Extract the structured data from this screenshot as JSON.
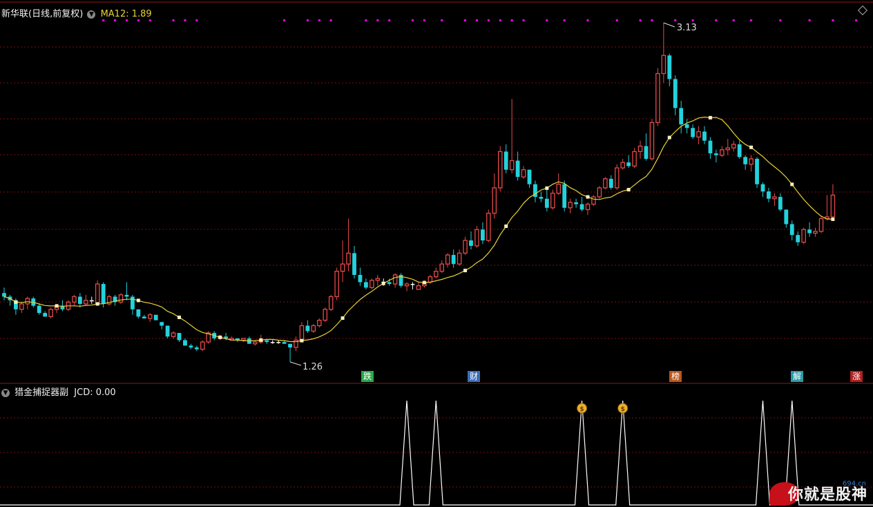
{
  "header": {
    "stock_title": "新华联(日线,前复权)",
    "ma_label": "MA12: 1.89",
    "indicator_title": "猎金捕捉器副",
    "indicator_value": "JCD: 0.00"
  },
  "annotations": {
    "high_label": "3.13",
    "low_label": "1.26"
  },
  "events": [
    {
      "text": "跌",
      "color": "#2aa84a"
    },
    {
      "text": "财",
      "color": "#3a6fb8"
    },
    {
      "text": "榜",
      "color": "#b8561f"
    },
    {
      "text": "解",
      "color": "#2b9aa8"
    },
    {
      "text": "涨",
      "color": "#b02020"
    }
  ],
  "colors": {
    "up": "#e84a4a",
    "down": "#22d2dc",
    "ma": "#e8d23a",
    "grid": "#7a1010",
    "signal": "#ff00ff"
  },
  "icons": [
    "money-bag-icon",
    "money-bag-icon"
  ],
  "watermark": {
    "site": "694.cn",
    "slogan": "你就是股神"
  },
  "chart_data": {
    "type": "candlestick",
    "price_range": [
      1.26,
      3.13
    ],
    "ma_period": 12,
    "candles": [
      [
        1.64,
        1.67,
        1.6,
        1.62
      ],
      [
        1.62,
        1.63,
        1.57,
        1.6
      ],
      [
        1.6,
        1.61,
        1.52,
        1.55
      ],
      [
        1.55,
        1.59,
        1.53,
        1.58
      ],
      [
        1.58,
        1.62,
        1.55,
        1.61
      ],
      [
        1.61,
        1.62,
        1.56,
        1.57
      ],
      [
        1.57,
        1.58,
        1.52,
        1.53
      ],
      [
        1.53,
        1.54,
        1.51,
        1.51
      ],
      [
        1.51,
        1.56,
        1.5,
        1.55
      ],
      [
        1.55,
        1.58,
        1.53,
        1.57
      ],
      [
        1.57,
        1.6,
        1.54,
        1.55
      ],
      [
        1.55,
        1.6,
        1.54,
        1.59
      ],
      [
        1.59,
        1.63,
        1.57,
        1.62
      ],
      [
        1.62,
        1.64,
        1.56,
        1.58
      ],
      [
        1.58,
        1.63,
        1.57,
        1.6
      ],
      [
        1.6,
        1.62,
        1.58,
        1.6
      ],
      [
        1.58,
        1.71,
        1.57,
        1.69
      ],
      [
        1.69,
        1.7,
        1.56,
        1.58
      ],
      [
        1.58,
        1.63,
        1.57,
        1.62
      ],
      [
        1.62,
        1.63,
        1.57,
        1.59
      ],
      [
        1.59,
        1.64,
        1.58,
        1.63
      ],
      [
        1.63,
        1.7,
        1.6,
        1.62
      ],
      [
        1.62,
        1.63,
        1.52,
        1.55
      ],
      [
        1.55,
        1.55,
        1.5,
        1.51
      ],
      [
        1.51,
        1.52,
        1.5,
        1.5
      ],
      [
        1.5,
        1.53,
        1.48,
        1.52
      ],
      [
        1.52,
        1.52,
        1.49,
        1.49
      ],
      [
        1.48,
        1.48,
        1.44,
        1.46
      ],
      [
        1.46,
        1.46,
        1.39,
        1.4
      ],
      [
        1.4,
        1.43,
        1.39,
        1.42
      ],
      [
        1.42,
        1.42,
        1.37,
        1.38
      ],
      [
        1.38,
        1.39,
        1.35,
        1.35
      ],
      [
        1.35,
        1.36,
        1.33,
        1.34
      ],
      [
        1.34,
        1.35,
        1.32,
        1.33
      ],
      [
        1.33,
        1.38,
        1.32,
        1.37
      ],
      [
        1.37,
        1.43,
        1.36,
        1.42
      ],
      [
        1.42,
        1.43,
        1.38,
        1.39
      ],
      [
        1.39,
        1.41,
        1.38,
        1.4
      ],
      [
        1.4,
        1.42,
        1.38,
        1.39
      ],
      [
        1.38,
        1.4,
        1.38,
        1.39
      ],
      [
        1.39,
        1.39,
        1.37,
        1.38
      ],
      [
        1.38,
        1.39,
        1.37,
        1.39
      ],
      [
        1.39,
        1.4,
        1.36,
        1.36
      ],
      [
        1.36,
        1.38,
        1.35,
        1.37
      ],
      [
        1.37,
        1.41,
        1.36,
        1.38
      ],
      [
        1.38,
        1.38,
        1.36,
        1.37
      ],
      [
        1.37,
        1.38,
        1.36,
        1.37
      ],
      [
        1.37,
        1.38,
        1.36,
        1.37
      ],
      [
        1.37,
        1.38,
        1.36,
        1.36
      ],
      [
        1.36,
        1.36,
        1.26,
        1.34
      ],
      [
        1.34,
        1.4,
        1.32,
        1.38
      ],
      [
        1.38,
        1.48,
        1.37,
        1.46
      ],
      [
        1.46,
        1.49,
        1.42,
        1.43
      ],
      [
        1.43,
        1.47,
        1.42,
        1.46
      ],
      [
        1.46,
        1.5,
        1.45,
        1.49
      ],
      [
        1.49,
        1.56,
        1.48,
        1.55
      ],
      [
        1.55,
        1.63,
        1.54,
        1.62
      ],
      [
        1.62,
        1.78,
        1.6,
        1.76
      ],
      [
        1.76,
        1.93,
        1.7,
        1.8
      ],
      [
        1.8,
        2.05,
        1.76,
        1.86
      ],
      [
        1.86,
        1.9,
        1.72,
        1.74
      ],
      [
        1.74,
        1.78,
        1.68,
        1.7
      ],
      [
        1.7,
        1.72,
        1.66,
        1.67
      ],
      [
        1.67,
        1.72,
        1.66,
        1.71
      ],
      [
        1.71,
        1.74,
        1.68,
        1.72
      ],
      [
        1.7,
        1.72,
        1.68,
        1.7
      ],
      [
        1.7,
        1.72,
        1.68,
        1.69
      ],
      [
        1.69,
        1.75,
        1.67,
        1.74
      ],
      [
        1.74,
        1.75,
        1.67,
        1.68
      ],
      [
        1.68,
        1.7,
        1.65,
        1.69
      ],
      [
        1.69,
        1.7,
        1.66,
        1.69
      ],
      [
        1.66,
        1.7,
        1.66,
        1.68
      ],
      [
        1.68,
        1.71,
        1.67,
        1.7
      ],
      [
        1.7,
        1.74,
        1.69,
        1.73
      ],
      [
        1.73,
        1.78,
        1.72,
        1.76
      ],
      [
        1.76,
        1.82,
        1.75,
        1.8
      ],
      [
        1.8,
        1.86,
        1.78,
        1.85
      ],
      [
        1.85,
        1.88,
        1.78,
        1.8
      ],
      [
        1.8,
        1.88,
        1.79,
        1.86
      ],
      [
        1.86,
        1.95,
        1.85,
        1.93
      ],
      [
        1.93,
        1.98,
        1.88,
        1.9
      ],
      [
        1.9,
        2.01,
        1.89,
        1.99
      ],
      [
        1.99,
        2.03,
        1.91,
        1.93
      ],
      [
        1.93,
        2.1,
        1.92,
        2.08
      ],
      [
        2.08,
        2.3,
        2.05,
        2.22
      ],
      [
        2.22,
        2.45,
        2.2,
        2.42
      ],
      [
        2.42,
        2.46,
        2.3,
        2.32
      ],
      [
        2.32,
        2.71,
        2.3,
        2.37
      ],
      [
        2.37,
        2.42,
        2.26,
        2.28
      ],
      [
        2.28,
        2.34,
        2.27,
        2.32
      ],
      [
        2.32,
        2.32,
        2.22,
        2.24
      ],
      [
        2.24,
        2.26,
        2.14,
        2.17
      ],
      [
        2.17,
        2.2,
        2.14,
        2.16
      ],
      [
        2.16,
        2.21,
        2.09,
        2.11
      ],
      [
        2.11,
        2.21,
        2.1,
        2.19
      ],
      [
        2.19,
        2.3,
        2.18,
        2.24
      ],
      [
        2.24,
        2.26,
        2.09,
        2.11
      ],
      [
        2.11,
        2.16,
        2.08,
        2.14
      ],
      [
        2.14,
        2.16,
        2.11,
        2.13
      ],
      [
        2.13,
        2.17,
        2.09,
        2.1
      ],
      [
        2.1,
        2.14,
        2.07,
        2.13
      ],
      [
        2.13,
        2.18,
        2.12,
        2.17
      ],
      [
        2.17,
        2.23,
        2.16,
        2.22
      ],
      [
        2.22,
        2.28,
        2.21,
        2.27
      ],
      [
        2.27,
        2.29,
        2.21,
        2.22
      ],
      [
        2.22,
        2.35,
        2.21,
        2.33
      ],
      [
        2.33,
        2.38,
        2.32,
        2.36
      ],
      [
        2.36,
        2.4,
        2.33,
        2.34
      ],
      [
        2.34,
        2.44,
        2.33,
        2.42
      ],
      [
        2.42,
        2.48,
        2.38,
        2.45
      ],
      [
        2.45,
        2.52,
        2.37,
        2.38
      ],
      [
        2.38,
        2.6,
        2.37,
        2.58
      ],
      [
        2.58,
        2.88,
        2.56,
        2.85
      ],
      [
        2.85,
        3.13,
        2.8,
        2.95
      ],
      [
        2.95,
        2.96,
        2.78,
        2.82
      ],
      [
        2.82,
        2.84,
        2.62,
        2.66
      ],
      [
        2.66,
        2.7,
        2.52,
        2.57
      ],
      [
        2.57,
        2.6,
        2.52,
        2.55
      ],
      [
        2.55,
        2.57,
        2.49,
        2.5
      ],
      [
        2.5,
        2.56,
        2.46,
        2.53
      ],
      [
        2.53,
        2.56,
        2.46,
        2.48
      ],
      [
        2.48,
        2.5,
        2.38,
        2.41
      ],
      [
        2.41,
        2.43,
        2.36,
        2.4
      ],
      [
        2.4,
        2.45,
        2.39,
        2.43
      ],
      [
        2.43,
        2.49,
        2.4,
        2.44
      ],
      [
        2.44,
        2.48,
        2.42,
        2.46
      ],
      [
        2.46,
        2.48,
        2.38,
        2.39
      ],
      [
        2.39,
        2.4,
        2.32,
        2.35
      ],
      [
        2.35,
        2.4,
        2.31,
        2.38
      ],
      [
        2.38,
        2.39,
        2.22,
        2.24
      ],
      [
        2.24,
        2.25,
        2.17,
        2.2
      ],
      [
        2.2,
        2.22,
        2.14,
        2.16
      ],
      [
        2.16,
        2.19,
        2.12,
        2.17
      ],
      [
        2.17,
        2.19,
        2.09,
        2.1
      ],
      [
        2.1,
        2.1,
        2.0,
        2.02
      ],
      [
        2.02,
        2.04,
        1.93,
        1.96
      ],
      [
        1.96,
        1.98,
        1.9,
        1.92
      ],
      [
        1.92,
        2.0,
        1.91,
        1.99
      ],
      [
        1.99,
        2.03,
        1.95,
        1.97
      ],
      [
        1.97,
        2.0,
        1.95,
        1.98
      ],
      [
        1.98,
        2.06,
        1.97,
        2.05
      ],
      [
        2.05,
        2.18,
        2.04,
        2.06
      ],
      [
        2.06,
        2.24,
        2.05,
        2.18
      ]
    ]
  },
  "indicator_data": {
    "type": "spike",
    "length": 148,
    "spike_indices": [
      69,
      74,
      99,
      106,
      130,
      135
    ],
    "icon_indices": [
      99,
      106
    ],
    "signal_indices": [
      17,
      19,
      21,
      23,
      25,
      29,
      31,
      33,
      48,
      52,
      54,
      56,
      62,
      64,
      66,
      70,
      72,
      75,
      79,
      81,
      83,
      85,
      87,
      89,
      93,
      96,
      100,
      105,
      109,
      111,
      115,
      118,
      122,
      125,
      128,
      133,
      138,
      142,
      146
    ]
  }
}
